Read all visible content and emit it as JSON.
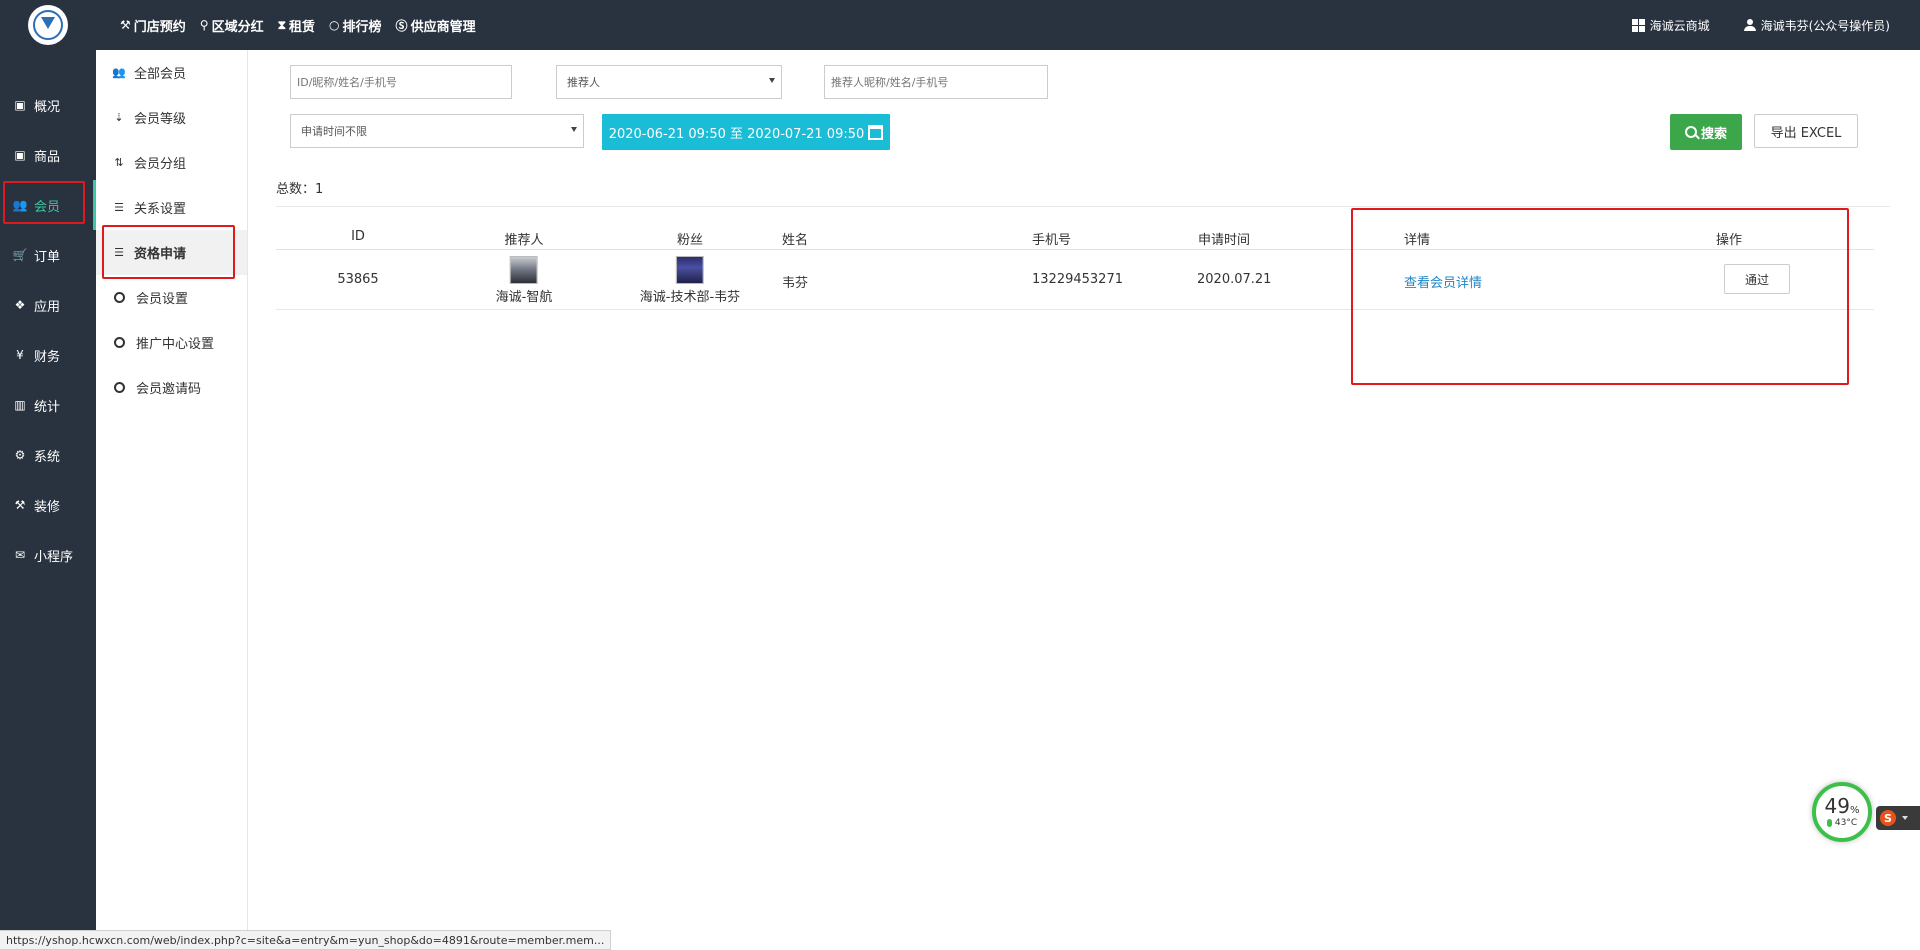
{
  "top_nav": [
    {
      "icon": "hammer-icon",
      "glyph": "⚒",
      "label": "门店预约"
    },
    {
      "icon": "pin-icon",
      "glyph": "⚲",
      "label": "区域分红"
    },
    {
      "icon": "hourglass-icon",
      "glyph": "⧗",
      "label": "租赁"
    },
    {
      "icon": "circle-icon",
      "glyph": "○",
      "label": "排行榜"
    },
    {
      "icon": "skype-icon",
      "glyph": "Ⓢ",
      "label": "供应商管理"
    }
  ],
  "top_right": {
    "store_label": "海诚云商城",
    "user_label": "海诚韦芬(公众号操作员)"
  },
  "main_nav": [
    {
      "icon": "overview-icon",
      "glyph": "▣",
      "label": "概况"
    },
    {
      "icon": "box-icon",
      "glyph": "▣",
      "label": "商品"
    },
    {
      "icon": "users-icon",
      "glyph": "👥",
      "label": "会员"
    },
    {
      "icon": "cart-icon",
      "glyph": "🛒",
      "label": "订单"
    },
    {
      "icon": "cubes-icon",
      "glyph": "❖",
      "label": "应用"
    },
    {
      "icon": "yen-icon",
      "glyph": "¥",
      "label": "财务"
    },
    {
      "icon": "bar-chart-icon",
      "glyph": "▥",
      "label": "统计"
    },
    {
      "icon": "gears-icon",
      "glyph": "⚙",
      "label": "系统"
    },
    {
      "icon": "gavel-icon",
      "glyph": "⚒",
      "label": "装修"
    },
    {
      "icon": "wechat-icon",
      "glyph": "✉",
      "label": "小程序"
    }
  ],
  "sub_nav": [
    {
      "icon": "users-icon",
      "glyph": "👥",
      "label": "全部会员"
    },
    {
      "icon": "sort-desc-icon",
      "glyph": "⇣",
      "label": "会员等级"
    },
    {
      "icon": "sort-numeric-icon",
      "glyph": "⇅",
      "label": "会员分组"
    },
    {
      "icon": "sliders-icon",
      "glyph": "☰",
      "label": "关系设置"
    },
    {
      "icon": "sliders-icon",
      "glyph": "☰",
      "label": "资格申请"
    },
    {
      "icon": "circle-icon",
      "glyph": "",
      "label": "会员设置"
    },
    {
      "icon": "circle-icon",
      "glyph": "",
      "label": "推广中心设置"
    },
    {
      "icon": "circle-icon",
      "glyph": "",
      "label": "会员邀请码"
    }
  ],
  "filters": {
    "keyword_placeholder": "ID/昵称/姓名/手机号",
    "referrer_select": "推荐人",
    "referrer_keyword_placeholder": "推荐人昵称/姓名/手机号",
    "time_select": "申请时间不限",
    "date_range": "2020-06-21 09:50 至 2020-07-21 09:50",
    "search_label": "搜索",
    "export_label": "导出 EXCEL"
  },
  "total_label": "总数：1",
  "table": {
    "headers": [
      "ID",
      "推荐人",
      "粉丝",
      "姓名",
      "手机号",
      "申请时间",
      "详情",
      "操作"
    ],
    "rows": [
      {
        "id": "53865",
        "referrer": "海诚-智航",
        "fan": "海诚-技术部-韦芬",
        "name": "韦芬",
        "phone": "13229453271",
        "apply_time": "2020.07.21",
        "detail_link": "查看会员详情",
        "action_label": "通过"
      }
    ]
  },
  "status_url": "https://yshop.hcwxcn.com/web/index.php?c=site&a=entry&m=yun_shop&do=4891&route=member.mem...",
  "perf_widget": {
    "percent": "49",
    "percent_unit": "%",
    "temperature": "43°C"
  },
  "ime_glyph": "S"
}
